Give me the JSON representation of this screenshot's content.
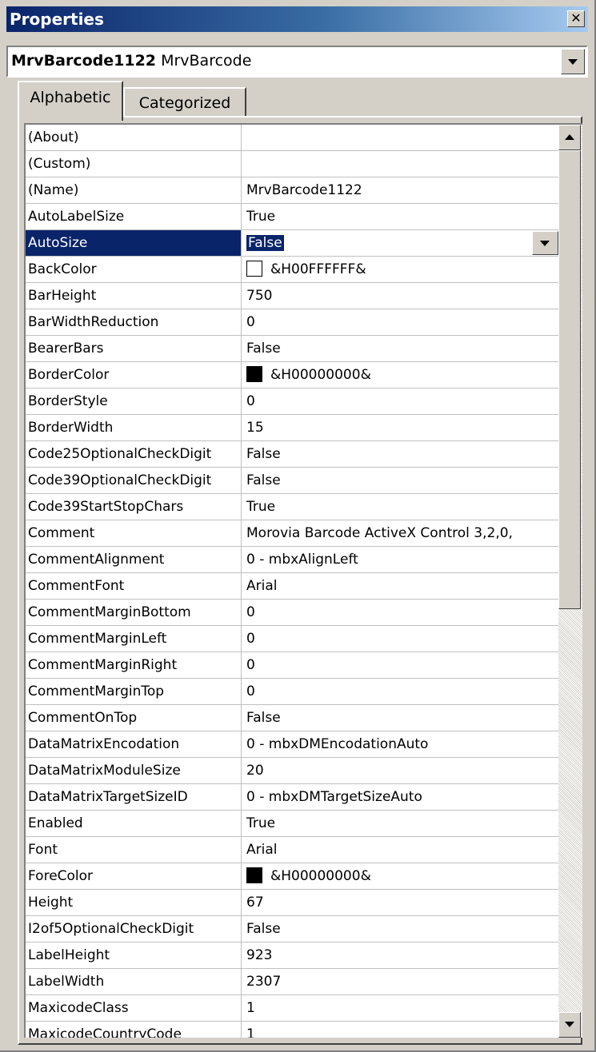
{
  "window": {
    "title": "Properties",
    "close_glyph": "✕"
  },
  "object_selector": {
    "name": "MrvBarcode1122",
    "type": "MrvBarcode"
  },
  "tabs": [
    {
      "label": "Alphabetic",
      "active": true
    },
    {
      "label": "Categorized",
      "active": false
    }
  ],
  "properties": [
    {
      "name": "(About)",
      "value": ""
    },
    {
      "name": "(Custom)",
      "value": ""
    },
    {
      "name": "(Name)",
      "value": "MrvBarcode1122"
    },
    {
      "name": "AutoLabelSize",
      "value": "True"
    },
    {
      "name": "AutoSize",
      "value": "False",
      "selected": true
    },
    {
      "name": "BackColor",
      "value": "&H00FFFFFF&",
      "swatch": "#ffffff"
    },
    {
      "name": "BarHeight",
      "value": "750"
    },
    {
      "name": "BarWidthReduction",
      "value": "0"
    },
    {
      "name": "BearerBars",
      "value": "False"
    },
    {
      "name": "BorderColor",
      "value": "&H00000000&",
      "swatch": "#000000"
    },
    {
      "name": "BorderStyle",
      "value": "0"
    },
    {
      "name": "BorderWidth",
      "value": "15"
    },
    {
      "name": "Code25OptionalCheckDigit",
      "value": "False"
    },
    {
      "name": "Code39OptionalCheckDigit",
      "value": "False"
    },
    {
      "name": "Code39StartStopChars",
      "value": "True"
    },
    {
      "name": "Comment",
      "value": "Morovia Barcode ActiveX Control 3,2,0,"
    },
    {
      "name": "CommentAlignment",
      "value": "0 - mbxAlignLeft"
    },
    {
      "name": "CommentFont",
      "value": "Arial"
    },
    {
      "name": "CommentMarginBottom",
      "value": "0"
    },
    {
      "name": "CommentMarginLeft",
      "value": "0"
    },
    {
      "name": "CommentMarginRight",
      "value": "0"
    },
    {
      "name": "CommentMarginTop",
      "value": "0"
    },
    {
      "name": "CommentOnTop",
      "value": "False"
    },
    {
      "name": "DataMatrixEncodation",
      "value": "0 - mbxDMEncodationAuto"
    },
    {
      "name": "DataMatrixModuleSize",
      "value": "20"
    },
    {
      "name": "DataMatrixTargetSizeID",
      "value": "0 - mbxDMTargetSizeAuto"
    },
    {
      "name": "Enabled",
      "value": "True"
    },
    {
      "name": "Font",
      "value": "Arial"
    },
    {
      "name": "ForeColor",
      "value": "&H00000000&",
      "swatch": "#000000"
    },
    {
      "name": "Height",
      "value": "67"
    },
    {
      "name": "I2of5OptionalCheckDigit",
      "value": "False"
    },
    {
      "name": "LabelHeight",
      "value": "923"
    },
    {
      "name": "LabelWidth",
      "value": "2307"
    },
    {
      "name": "MaxicodeClass",
      "value": "1"
    },
    {
      "name": "MaxicodeCountryCode",
      "value": "1"
    }
  ],
  "scrollbar": {
    "up_glyph": "up-arrow-icon",
    "down_glyph": "down-arrow-icon"
  },
  "colors": {
    "title_bar": "#0a246a",
    "selection": "#0a246a",
    "face": "#d4d0c8"
  }
}
